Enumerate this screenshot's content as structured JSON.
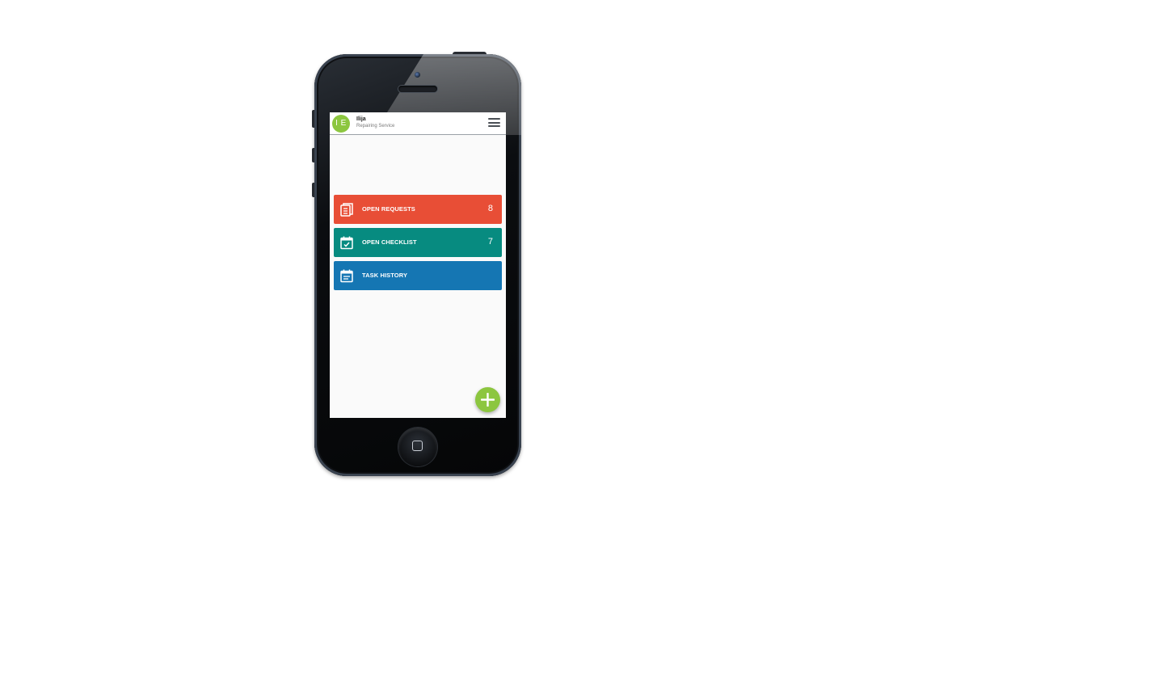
{
  "colors": {
    "brand_green": "#8cc63f",
    "open_requests": "#e84e36",
    "open_checklist": "#078b80",
    "task_history": "#1576b3"
  },
  "header": {
    "avatar_initials": "I E",
    "user_name": "Ilija",
    "user_subtitle": "Repairing Service",
    "menu_icon": "hamburger-menu-icon"
  },
  "tiles": [
    {
      "label": "OPEN REQUESTS",
      "count": "8",
      "icon": "requests-list-icon"
    },
    {
      "label": "OPEN CHECKLIST",
      "count": "7",
      "icon": "calendar-check-icon"
    },
    {
      "label": "TASK HISTORY",
      "count": "",
      "icon": "calendar-notes-icon"
    }
  ],
  "fab": {
    "icon": "plus-icon"
  }
}
